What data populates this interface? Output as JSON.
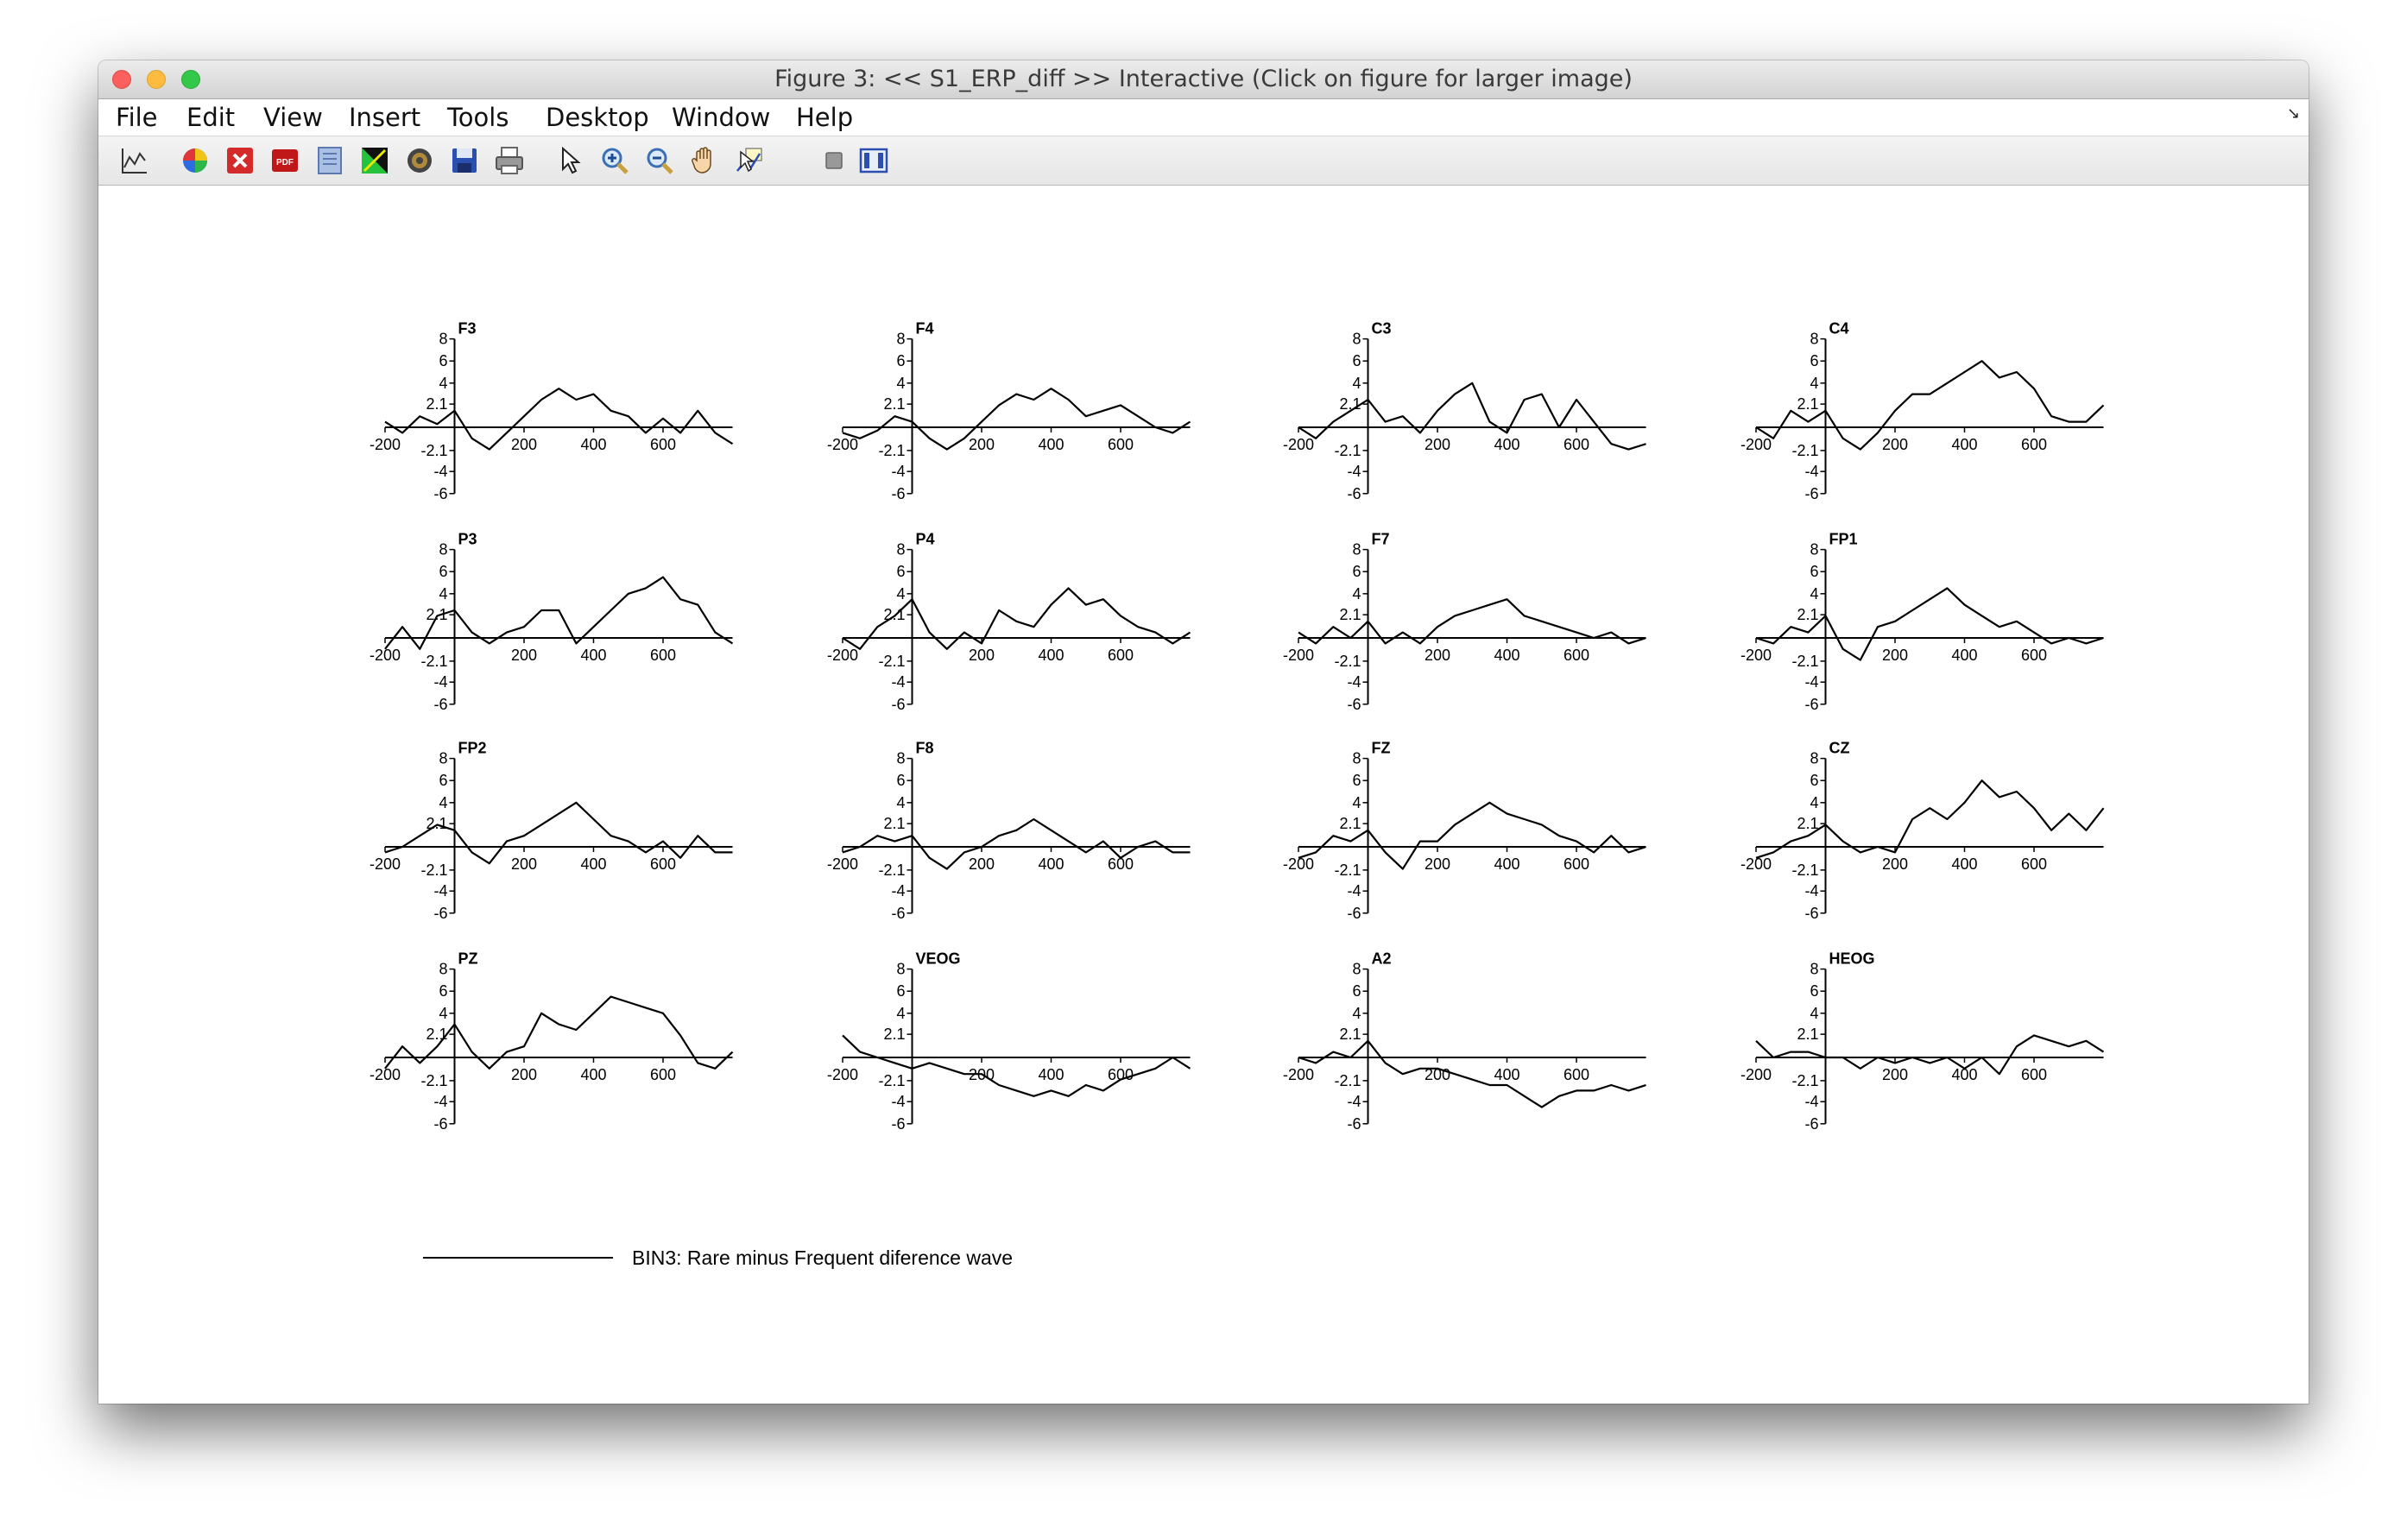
{
  "window": {
    "title": "Figure 3: << S1_ERP_diff >>  Interactive (Click on figure for larger image)"
  },
  "menu": [
    "File",
    "Edit",
    "View",
    "Insert",
    "Tools",
    "Desktop",
    "Window",
    "Help"
  ],
  "toolbar": {
    "icons": [
      "plot-tools-icon",
      "colormap-icon",
      "close-red-icon",
      "pdf-icon",
      "page-icon",
      "topography-icon",
      "target-icon",
      "save-icon",
      "print-icon",
      "pointer-arrow-icon",
      "zoom-in-icon",
      "zoom-out-icon",
      "pan-hand-icon",
      "data-cursor-icon",
      "hide-plot-tools-icon",
      "show-plot-tools-icon"
    ]
  },
  "chart_data": {
    "type": "line",
    "layout": "4x4 grid of ERP channel plots",
    "x_ticks": [
      -200,
      200,
      400,
      600
    ],
    "y_ticks": [
      "8",
      "6",
      "4",
      "2.1",
      "-2.1",
      "-4",
      "-6"
    ],
    "xlim": [
      -200,
      800
    ],
    "ylim": [
      -6,
      8
    ],
    "legend": {
      "label": "BIN3: Rare minus Frequent diference wave",
      "placement": "bottom-left"
    },
    "channels": [
      {
        "name": "F3",
        "x": [
          -200,
          -150,
          -100,
          -50,
          0,
          50,
          100,
          150,
          200,
          250,
          300,
          350,
          400,
          450,
          500,
          550,
          600,
          650,
          700,
          750,
          800
        ],
        "y": [
          0.5,
          -0.5,
          1.0,
          0.3,
          1.5,
          -1.0,
          -2.0,
          -0.5,
          1.0,
          2.5,
          3.5,
          2.5,
          3.0,
          1.5,
          1.0,
          -0.5,
          0.8,
          -0.5,
          1.5,
          -0.5,
          -1.5
        ]
      },
      {
        "name": "F4",
        "x": [
          -200,
          -150,
          -100,
          -50,
          0,
          50,
          100,
          150,
          200,
          250,
          300,
          350,
          400,
          450,
          500,
          550,
          600,
          650,
          700,
          750,
          800
        ],
        "y": [
          -0.5,
          -1.0,
          -0.3,
          1.0,
          0.5,
          -1.0,
          -2.0,
          -1.0,
          0.5,
          2.0,
          3.0,
          2.5,
          3.5,
          2.5,
          1.0,
          1.5,
          2.0,
          1.0,
          0,
          -0.5,
          0.5
        ]
      },
      {
        "name": "C3",
        "x": [
          -200,
          -150,
          -100,
          -50,
          0,
          50,
          100,
          150,
          200,
          250,
          300,
          350,
          400,
          450,
          500,
          550,
          600,
          650,
          700,
          750,
          800
        ],
        "y": [
          0,
          -1.0,
          0.5,
          1.5,
          2.5,
          0.5,
          1.0,
          -0.5,
          1.5,
          3.0,
          4.0,
          0.5,
          -0.5,
          2.5,
          3.0,
          0,
          2.5,
          0.5,
          -1.5,
          -2.0,
          -1.5
        ]
      },
      {
        "name": "C4",
        "x": [
          -200,
          -150,
          -100,
          -50,
          0,
          50,
          100,
          150,
          200,
          250,
          300,
          350,
          400,
          450,
          500,
          550,
          600,
          650,
          700,
          750,
          800
        ],
        "y": [
          0,
          -1.0,
          1.5,
          0.5,
          1.5,
          -1.0,
          -2.0,
          -0.5,
          1.5,
          3.0,
          3.0,
          4.0,
          5.0,
          6.0,
          4.5,
          5.0,
          3.5,
          1.0,
          0.5,
          0.5,
          2.0
        ]
      },
      {
        "name": "P3",
        "x": [
          -200,
          -150,
          -100,
          -50,
          0,
          50,
          100,
          150,
          200,
          250,
          300,
          350,
          400,
          450,
          500,
          550,
          600,
          650,
          700,
          750,
          800
        ],
        "y": [
          -1.0,
          1.0,
          -1.0,
          2.0,
          2.5,
          0.5,
          -0.5,
          0.5,
          1.0,
          2.5,
          2.5,
          -0.5,
          1.0,
          2.5,
          4.0,
          4.5,
          5.5,
          3.5,
          3.0,
          0.5,
          -0.5
        ]
      },
      {
        "name": "P4",
        "x": [
          -200,
          -150,
          -100,
          -50,
          0,
          50,
          100,
          150,
          200,
          250,
          300,
          350,
          400,
          450,
          500,
          550,
          600,
          650,
          700,
          750,
          800
        ],
        "y": [
          0,
          -1.0,
          1.0,
          2.0,
          3.5,
          0.5,
          -1.0,
          0.5,
          -0.5,
          2.5,
          1.5,
          1.0,
          3.0,
          4.5,
          3.0,
          3.5,
          2.0,
          1.0,
          0.5,
          -0.5,
          0.5
        ]
      },
      {
        "name": "F7",
        "x": [
          -200,
          -150,
          -100,
          -50,
          0,
          50,
          100,
          150,
          200,
          250,
          300,
          350,
          400,
          450,
          500,
          550,
          600,
          650,
          700,
          750,
          800
        ],
        "y": [
          0.5,
          -0.5,
          1.0,
          0,
          1.5,
          -0.5,
          0.5,
          -0.5,
          1.0,
          2.0,
          2.5,
          3.0,
          3.5,
          2.0,
          1.5,
          1.0,
          0.5,
          0,
          0.5,
          -0.5,
          0
        ]
      },
      {
        "name": "FP1",
        "x": [
          -200,
          -150,
          -100,
          -50,
          0,
          50,
          100,
          150,
          200,
          250,
          300,
          350,
          400,
          450,
          500,
          550,
          600,
          650,
          700,
          750,
          800
        ],
        "y": [
          0,
          -0.5,
          1.0,
          0.5,
          2.0,
          -1.0,
          -2.0,
          1.0,
          1.5,
          2.5,
          3.5,
          4.5,
          3.0,
          2.0,
          1.0,
          1.5,
          0.5,
          -0.5,
          0,
          -0.5,
          0
        ]
      },
      {
        "name": "FP2",
        "x": [
          -200,
          -150,
          -100,
          -50,
          0,
          50,
          100,
          150,
          200,
          250,
          300,
          350,
          400,
          450,
          500,
          550,
          600,
          650,
          700,
          750,
          800
        ],
        "y": [
          -0.5,
          0,
          1.0,
          2.0,
          1.5,
          -0.5,
          -1.5,
          0.5,
          1.0,
          2.0,
          3.0,
          4.0,
          2.5,
          1.0,
          0.5,
          -0.5,
          0.5,
          -1.0,
          1.0,
          -0.5,
          -0.5
        ]
      },
      {
        "name": "F8",
        "x": [
          -200,
          -150,
          -100,
          -50,
          0,
          50,
          100,
          150,
          200,
          250,
          300,
          350,
          400,
          450,
          500,
          550,
          600,
          650,
          700,
          750,
          800
        ],
        "y": [
          -0.5,
          0,
          1.0,
          0.5,
          1.0,
          -1.0,
          -2.0,
          -0.5,
          0,
          1.0,
          1.5,
          2.5,
          1.5,
          0.5,
          -0.5,
          0.5,
          -1.0,
          0,
          0.5,
          -0.5,
          -0.5
        ]
      },
      {
        "name": "FZ",
        "x": [
          -200,
          -150,
          -100,
          -50,
          0,
          50,
          100,
          150,
          200,
          250,
          300,
          350,
          400,
          450,
          500,
          550,
          600,
          650,
          700,
          750,
          800
        ],
        "y": [
          -1.0,
          -0.5,
          1.0,
          0.5,
          1.5,
          -0.5,
          -2.0,
          0.5,
          0.5,
          2.0,
          3.0,
          4.0,
          3.0,
          2.5,
          2.0,
          1.0,
          0.5,
          -0.5,
          1.0,
          -0.5,
          0
        ]
      },
      {
        "name": "CZ",
        "x": [
          -200,
          -150,
          -100,
          -50,
          0,
          50,
          100,
          150,
          200,
          250,
          300,
          350,
          400,
          450,
          500,
          550,
          600,
          650,
          700,
          750,
          800
        ],
        "y": [
          -1.0,
          -0.5,
          0.5,
          1.0,
          2.0,
          0.5,
          -0.5,
          0,
          -0.5,
          2.5,
          3.5,
          2.5,
          4.0,
          6.0,
          4.5,
          5.0,
          3.5,
          1.5,
          3.0,
          1.5,
          3.5
        ]
      },
      {
        "name": "PZ",
        "x": [
          -200,
          -150,
          -100,
          -50,
          0,
          50,
          100,
          150,
          200,
          250,
          300,
          350,
          400,
          450,
          500,
          550,
          600,
          650,
          700,
          750,
          800
        ],
        "y": [
          -1.0,
          1.0,
          -0.5,
          1.0,
          3.0,
          0.5,
          -1.0,
          0.5,
          1.0,
          4.0,
          3.0,
          2.5,
          4.0,
          5.5,
          5.0,
          4.5,
          4.0,
          2.0,
          -0.5,
          -1.0,
          0.5
        ]
      },
      {
        "name": "VEOG",
        "x": [
          -200,
          -150,
          -100,
          -50,
          0,
          50,
          100,
          150,
          200,
          250,
          300,
          350,
          400,
          450,
          500,
          550,
          600,
          650,
          700,
          750,
          800
        ],
        "y": [
          2.0,
          0.5,
          0,
          -0.5,
          -1.0,
          -0.5,
          -1.0,
          -1.5,
          -1.5,
          -2.5,
          -3.0,
          -3.5,
          -3.0,
          -3.5,
          -2.5,
          -3.0,
          -2.0,
          -1.5,
          -1.0,
          0,
          -1.0
        ]
      },
      {
        "name": "A2",
        "x": [
          -200,
          -150,
          -100,
          -50,
          0,
          50,
          100,
          150,
          200,
          250,
          300,
          350,
          400,
          450,
          500,
          550,
          600,
          650,
          700,
          750,
          800
        ],
        "y": [
          0,
          -0.5,
          0.5,
          0,
          1.5,
          -0.5,
          -1.5,
          -1.0,
          -1.0,
          -1.5,
          -2.0,
          -2.5,
          -2.5,
          -3.5,
          -4.5,
          -3.5,
          -3.0,
          -3.0,
          -2.5,
          -3.0,
          -2.5
        ]
      },
      {
        "name": "HEOG",
        "x": [
          -200,
          -150,
          -100,
          -50,
          0,
          50,
          100,
          150,
          200,
          250,
          300,
          350,
          400,
          450,
          500,
          550,
          600,
          650,
          700,
          750,
          800
        ],
        "y": [
          1.5,
          0,
          0.5,
          0.5,
          0,
          0,
          -1.0,
          0,
          -0.5,
          0,
          -0.5,
          0,
          -1.0,
          0,
          -1.5,
          1.0,
          2.0,
          1.5,
          1.0,
          1.5,
          0.5
        ]
      }
    ]
  }
}
